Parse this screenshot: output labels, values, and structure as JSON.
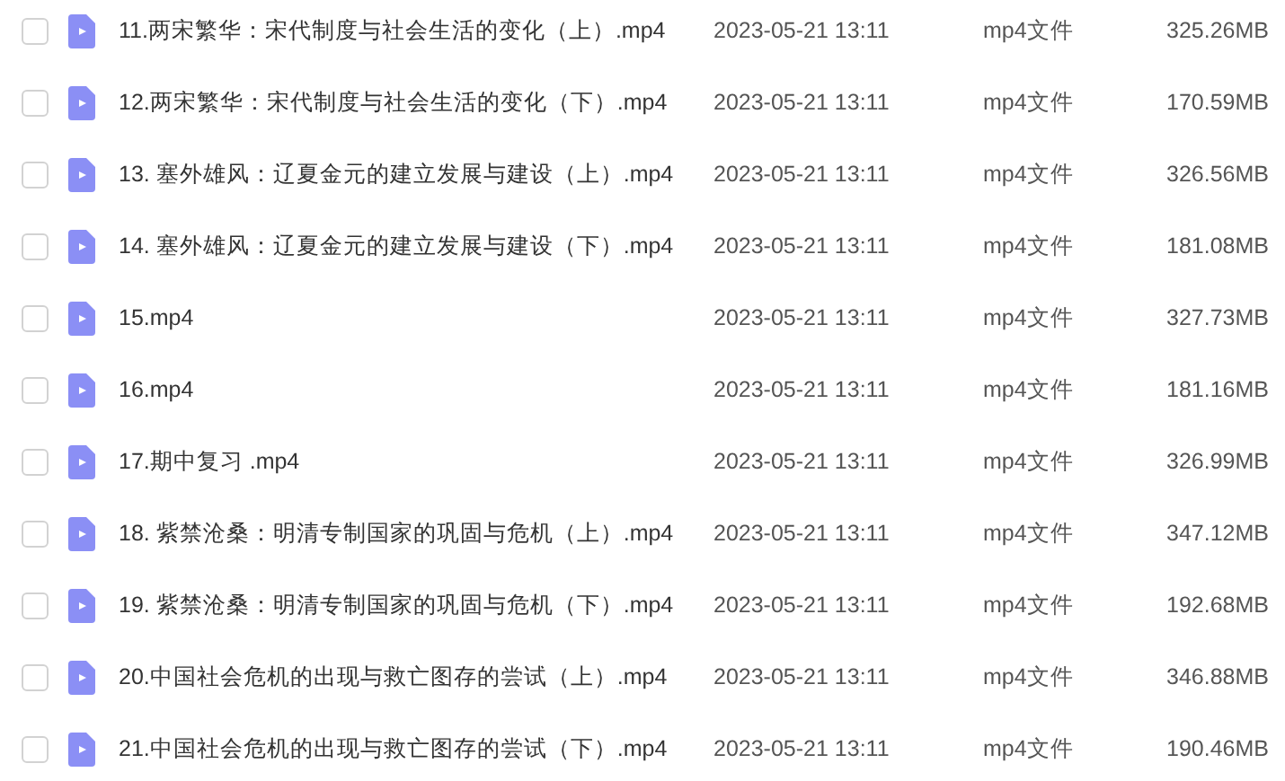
{
  "files": [
    {
      "name": "11.两宋繁华：宋代制度与社会生活的变化（上）.mp4",
      "date": "2023-05-21 13:11",
      "type": "mp4文件",
      "size": "325.26MB",
      "checked": false
    },
    {
      "name": "12.两宋繁华：宋代制度与社会生活的变化（下）.mp4",
      "date": "2023-05-21 13:11",
      "type": "mp4文件",
      "size": "170.59MB",
      "checked": false
    },
    {
      "name": "13. 塞外雄风：辽夏金元的建立发展与建设（上）.mp4",
      "date": "2023-05-21 13:11",
      "type": "mp4文件",
      "size": "326.56MB",
      "checked": false
    },
    {
      "name": "14. 塞外雄风：辽夏金元的建立发展与建设（下）.mp4",
      "date": "2023-05-21 13:11",
      "type": "mp4文件",
      "size": "181.08MB",
      "checked": false
    },
    {
      "name": "15.mp4",
      "date": "2023-05-21 13:11",
      "type": "mp4文件",
      "size": "327.73MB",
      "checked": false
    },
    {
      "name": "16.mp4",
      "date": "2023-05-21 13:11",
      "type": "mp4文件",
      "size": "181.16MB",
      "checked": false
    },
    {
      "name": "17.期中复习 .mp4",
      "date": "2023-05-21 13:11",
      "type": "mp4文件",
      "size": "326.99MB",
      "checked": false
    },
    {
      "name": "18. 紫禁沧桑：明清专制国家的巩固与危机（上）.mp4",
      "date": "2023-05-21 13:11",
      "type": "mp4文件",
      "size": "347.12MB",
      "checked": false
    },
    {
      "name": "19. 紫禁沧桑：明清专制国家的巩固与危机（下）.mp4",
      "date": "2023-05-21 13:11",
      "type": "mp4文件",
      "size": "192.68MB",
      "checked": false
    },
    {
      "name": "20.中国社会危机的出现与救亡图存的尝试（上）.mp4",
      "date": "2023-05-21 13:11",
      "type": "mp4文件",
      "size": "346.88MB",
      "checked": false
    },
    {
      "name": "21.中国社会危机的出现与救亡图存的尝试（下）.mp4",
      "date": "2023-05-21 13:11",
      "type": "mp4文件",
      "size": "190.46MB",
      "checked": false
    }
  ]
}
